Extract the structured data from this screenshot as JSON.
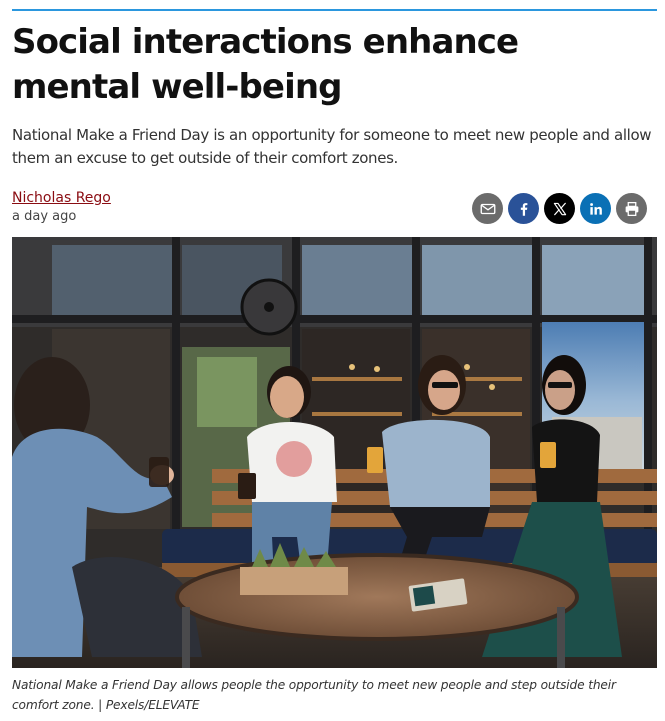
{
  "article": {
    "headline": "Social interactions enhance mental well-being",
    "dek": "National Make a Friend Day is an opportunity for someone to meet new people and allow them an excuse to get outside of their comfort zones.",
    "author": "Nicholas Rego",
    "published": "a day ago",
    "caption": "National Make a Friend Day allows people the opportunity to meet new people and step outside their comfort zone. | Pexels/ELEVATE"
  },
  "share": {
    "buttons": [
      {
        "icon": "envelope-icon",
        "color": "#6b6b6b"
      },
      {
        "icon": "facebook-f-icon",
        "color": "#2a5298"
      },
      {
        "icon": "x-logo-icon",
        "color": "#000000"
      },
      {
        "icon": "linkedin-icon",
        "color": "#0a70b5"
      },
      {
        "icon": "printer-icon",
        "color": "#6b6b6b"
      }
    ]
  },
  "colors": {
    "accent_rule": "#2b97de",
    "author_link": "#8a0c12"
  }
}
